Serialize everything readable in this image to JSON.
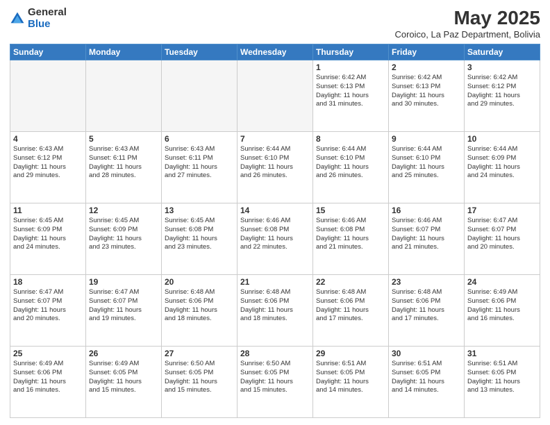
{
  "header": {
    "logo_general": "General",
    "logo_blue": "Blue",
    "main_title": "May 2025",
    "subtitle": "Coroico, La Paz Department, Bolivia"
  },
  "days_of_week": [
    "Sunday",
    "Monday",
    "Tuesday",
    "Wednesday",
    "Thursday",
    "Friday",
    "Saturday"
  ],
  "weeks": [
    [
      {
        "day": "",
        "info": ""
      },
      {
        "day": "",
        "info": ""
      },
      {
        "day": "",
        "info": ""
      },
      {
        "day": "",
        "info": ""
      },
      {
        "day": "1",
        "info": "Sunrise: 6:42 AM\nSunset: 6:13 PM\nDaylight: 11 hours\nand 31 minutes."
      },
      {
        "day": "2",
        "info": "Sunrise: 6:42 AM\nSunset: 6:13 PM\nDaylight: 11 hours\nand 30 minutes."
      },
      {
        "day": "3",
        "info": "Sunrise: 6:42 AM\nSunset: 6:12 PM\nDaylight: 11 hours\nand 29 minutes."
      }
    ],
    [
      {
        "day": "4",
        "info": "Sunrise: 6:43 AM\nSunset: 6:12 PM\nDaylight: 11 hours\nand 29 minutes."
      },
      {
        "day": "5",
        "info": "Sunrise: 6:43 AM\nSunset: 6:11 PM\nDaylight: 11 hours\nand 28 minutes."
      },
      {
        "day": "6",
        "info": "Sunrise: 6:43 AM\nSunset: 6:11 PM\nDaylight: 11 hours\nand 27 minutes."
      },
      {
        "day": "7",
        "info": "Sunrise: 6:44 AM\nSunset: 6:10 PM\nDaylight: 11 hours\nand 26 minutes."
      },
      {
        "day": "8",
        "info": "Sunrise: 6:44 AM\nSunset: 6:10 PM\nDaylight: 11 hours\nand 26 minutes."
      },
      {
        "day": "9",
        "info": "Sunrise: 6:44 AM\nSunset: 6:10 PM\nDaylight: 11 hours\nand 25 minutes."
      },
      {
        "day": "10",
        "info": "Sunrise: 6:44 AM\nSunset: 6:09 PM\nDaylight: 11 hours\nand 24 minutes."
      }
    ],
    [
      {
        "day": "11",
        "info": "Sunrise: 6:45 AM\nSunset: 6:09 PM\nDaylight: 11 hours\nand 24 minutes."
      },
      {
        "day": "12",
        "info": "Sunrise: 6:45 AM\nSunset: 6:09 PM\nDaylight: 11 hours\nand 23 minutes."
      },
      {
        "day": "13",
        "info": "Sunrise: 6:45 AM\nSunset: 6:08 PM\nDaylight: 11 hours\nand 23 minutes."
      },
      {
        "day": "14",
        "info": "Sunrise: 6:46 AM\nSunset: 6:08 PM\nDaylight: 11 hours\nand 22 minutes."
      },
      {
        "day": "15",
        "info": "Sunrise: 6:46 AM\nSunset: 6:08 PM\nDaylight: 11 hours\nand 21 minutes."
      },
      {
        "day": "16",
        "info": "Sunrise: 6:46 AM\nSunset: 6:07 PM\nDaylight: 11 hours\nand 21 minutes."
      },
      {
        "day": "17",
        "info": "Sunrise: 6:47 AM\nSunset: 6:07 PM\nDaylight: 11 hours\nand 20 minutes."
      }
    ],
    [
      {
        "day": "18",
        "info": "Sunrise: 6:47 AM\nSunset: 6:07 PM\nDaylight: 11 hours\nand 20 minutes."
      },
      {
        "day": "19",
        "info": "Sunrise: 6:47 AM\nSunset: 6:07 PM\nDaylight: 11 hours\nand 19 minutes."
      },
      {
        "day": "20",
        "info": "Sunrise: 6:48 AM\nSunset: 6:06 PM\nDaylight: 11 hours\nand 18 minutes."
      },
      {
        "day": "21",
        "info": "Sunrise: 6:48 AM\nSunset: 6:06 PM\nDaylight: 11 hours\nand 18 minutes."
      },
      {
        "day": "22",
        "info": "Sunrise: 6:48 AM\nSunset: 6:06 PM\nDaylight: 11 hours\nand 17 minutes."
      },
      {
        "day": "23",
        "info": "Sunrise: 6:48 AM\nSunset: 6:06 PM\nDaylight: 11 hours\nand 17 minutes."
      },
      {
        "day": "24",
        "info": "Sunrise: 6:49 AM\nSunset: 6:06 PM\nDaylight: 11 hours\nand 16 minutes."
      }
    ],
    [
      {
        "day": "25",
        "info": "Sunrise: 6:49 AM\nSunset: 6:06 PM\nDaylight: 11 hours\nand 16 minutes."
      },
      {
        "day": "26",
        "info": "Sunrise: 6:49 AM\nSunset: 6:05 PM\nDaylight: 11 hours\nand 15 minutes."
      },
      {
        "day": "27",
        "info": "Sunrise: 6:50 AM\nSunset: 6:05 PM\nDaylight: 11 hours\nand 15 minutes."
      },
      {
        "day": "28",
        "info": "Sunrise: 6:50 AM\nSunset: 6:05 PM\nDaylight: 11 hours\nand 15 minutes."
      },
      {
        "day": "29",
        "info": "Sunrise: 6:51 AM\nSunset: 6:05 PM\nDaylight: 11 hours\nand 14 minutes."
      },
      {
        "day": "30",
        "info": "Sunrise: 6:51 AM\nSunset: 6:05 PM\nDaylight: 11 hours\nand 14 minutes."
      },
      {
        "day": "31",
        "info": "Sunrise: 6:51 AM\nSunset: 6:05 PM\nDaylight: 11 hours\nand 13 minutes."
      }
    ]
  ]
}
